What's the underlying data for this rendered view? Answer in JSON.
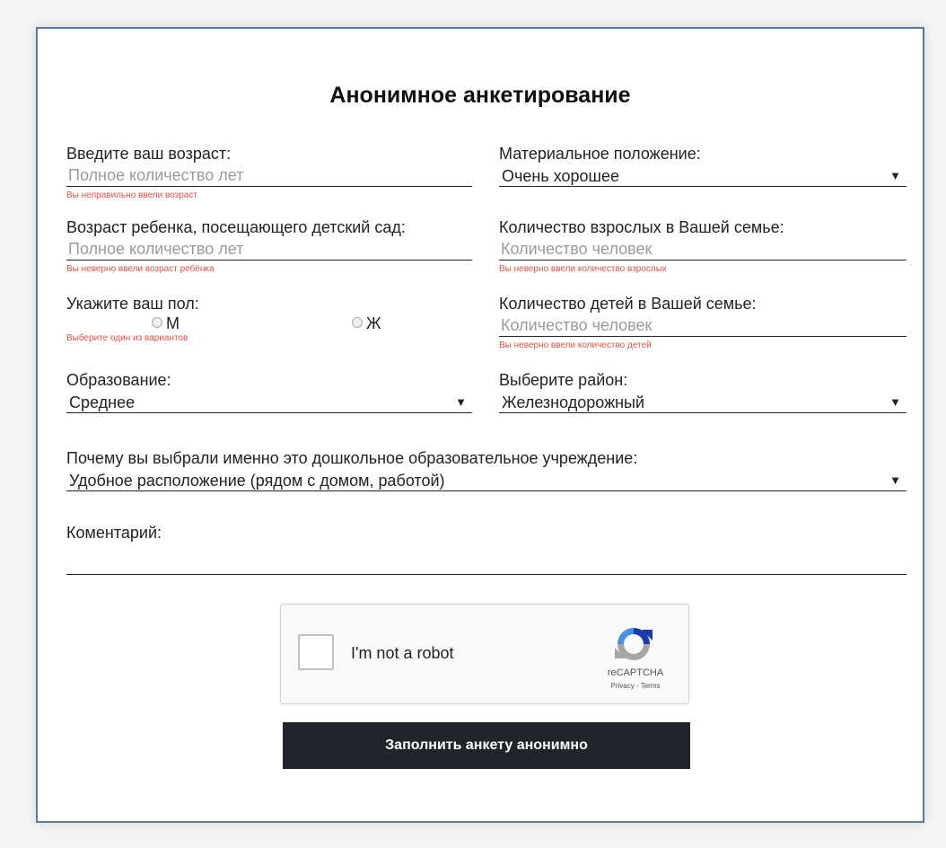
{
  "form": {
    "title": "Анонимное анкетирование",
    "age": {
      "label": "Введите ваш возраст:",
      "placeholder": "Полное количество лет",
      "error": "Вы неправильно ввели возраст"
    },
    "child_age": {
      "label": "Возраст ребенка, посещающего детский сад:",
      "placeholder": "Полное количество лет",
      "error": "Вы неверно ввели возраст ребёнка"
    },
    "gender": {
      "label": "Укажите ваш пол:",
      "options": [
        "М",
        "Ж"
      ],
      "error": "Выберите один из вариантов"
    },
    "education": {
      "label": "Образование:",
      "value": "Среднее"
    },
    "financial": {
      "label": "Материальное положение:",
      "value": "Очень хорошее"
    },
    "adults": {
      "label": "Количество взрослых в Вашей семье:",
      "placeholder": "Количество человек",
      "error": "Вы неверно ввели количество взрослых"
    },
    "children": {
      "label": "Количество детей в Вашей семье:",
      "placeholder": "Количество человек",
      "error": "Вы неверно ввели количество детей"
    },
    "district": {
      "label": "Выберите район:",
      "value": "Железнодорожный"
    },
    "reason": {
      "label": "Почему вы выбрали именно это дошкольное образовательное учреждение:",
      "value": "Удобное расположение (рядом с домом, работой)"
    },
    "comment": {
      "label": "Коментарий:"
    },
    "dropdown_arrow": "▼",
    "captcha": {
      "text": "I'm not a robot",
      "brand": "reCAPTCHA",
      "links": "Privacy - Terms"
    },
    "submit_label": "Заполнить анкету анонимно"
  }
}
